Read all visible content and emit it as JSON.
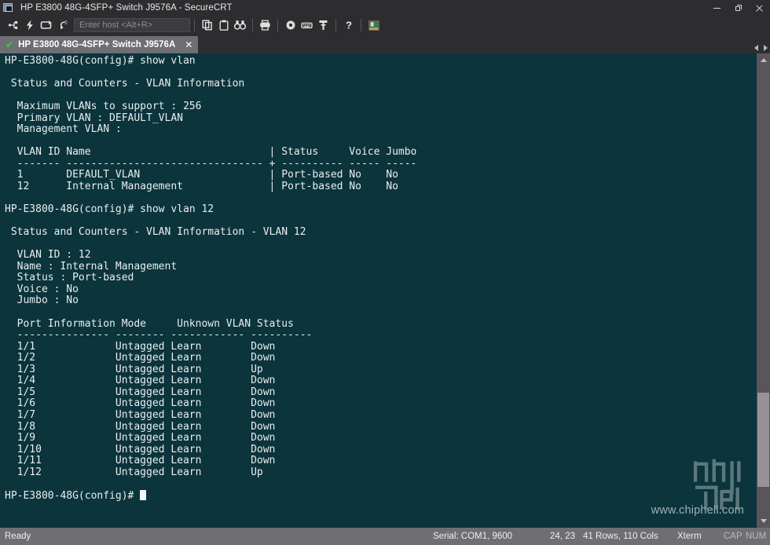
{
  "window": {
    "title": "HP E3800 48G-4SFP+ Switch J9576A - SecureCRT",
    "icon": "securecrt-app-icon",
    "controls": {
      "minimize": "minimize",
      "restore": "restore",
      "close": "close"
    }
  },
  "toolbar": {
    "buttons": [
      {
        "name": "connect-icon",
        "label": "Connect"
      },
      {
        "name": "quick-connect-icon",
        "label": "Quick Connect"
      },
      {
        "name": "reconnect-icon",
        "label": "Reconnect"
      },
      {
        "name": "disconnect-icon",
        "label": "Disconnect"
      }
    ],
    "host_input": {
      "placeholder": "Enter host <Alt+R>",
      "value": ""
    },
    "actions": [
      {
        "name": "copy-icon",
        "label": "Copy"
      },
      {
        "name": "paste-icon",
        "label": "Paste"
      },
      {
        "name": "find-icon",
        "label": "Find"
      },
      {
        "name": "print-icon",
        "label": "Print"
      },
      {
        "name": "settings-gear-icon",
        "label": "Session Options"
      },
      {
        "name": "keymap-icon",
        "label": "Keymap Editor"
      },
      {
        "name": "key-icon",
        "label": "Public Key"
      },
      {
        "name": "help-icon",
        "label": "Help"
      },
      {
        "name": "chat-window-icon",
        "label": "Chat Window"
      }
    ]
  },
  "tab": {
    "label": "HP E3800 48G-4SFP+ Switch J9576A",
    "status_glyph": "✔",
    "close_glyph": "✕",
    "nav_prev": "prev-tab",
    "nav_next": "next-tab"
  },
  "terminal": {
    "background_color": "#0b343c",
    "foreground_color": "#e9eef0",
    "cursor": "block",
    "lines": [
      "HP-E3800-48G(config)# show vlan",
      "",
      " Status and Counters - VLAN Information",
      "",
      "  Maximum VLANs to support : 256",
      "  Primary VLAN : DEFAULT_VLAN",
      "  Management VLAN :",
      "",
      "  VLAN ID Name                             | Status     Voice Jumbo",
      "  ------- -------------------------------- + ---------- ----- -----",
      "  1       DEFAULT_VLAN                     | Port-based No    No",
      "  12      Internal Management              | Port-based No    No",
      "",
      "HP-E3800-48G(config)# show vlan 12",
      "",
      " Status and Counters - VLAN Information - VLAN 12",
      "",
      "  VLAN ID : 12",
      "  Name : Internal Management",
      "  Status : Port-based",
      "  Voice : No",
      "  Jumbo : No",
      "",
      "  Port Information Mode     Unknown VLAN Status",
      "  --------------- -------- ------------ ----------",
      "  1/1             Untagged Learn        Down",
      "  1/2             Untagged Learn        Down",
      "  1/3             Untagged Learn        Up",
      "  1/4             Untagged Learn        Down",
      "  1/5             Untagged Learn        Down",
      "  1/6             Untagged Learn        Down",
      "  1/7             Untagged Learn        Down",
      "  1/8             Untagged Learn        Down",
      "  1/9             Untagged Learn        Down",
      "  1/10            Untagged Learn        Down",
      "  1/11            Untagged Learn        Down",
      "  1/12            Untagged Learn        Up",
      "",
      ""
    ],
    "prompt": "HP-E3800-48G(config)# "
  },
  "vlan_summary": {
    "maximum_vlans_to_support": "256",
    "primary_vlan": "DEFAULT_VLAN",
    "management_vlan": "",
    "columns": [
      "VLAN ID",
      "Name",
      "Status",
      "Voice",
      "Jumbo"
    ],
    "rows": [
      {
        "vlan_id": "1",
        "name": "DEFAULT_VLAN",
        "status": "Port-based",
        "voice": "No",
        "jumbo": "No"
      },
      {
        "vlan_id": "12",
        "name": "Internal Management",
        "status": "Port-based",
        "voice": "No",
        "jumbo": "No"
      }
    ]
  },
  "vlan_detail": {
    "vlan_id": "12",
    "name": "Internal Management",
    "status": "Port-based",
    "voice": "No",
    "jumbo": "No",
    "columns": [
      "Port Information",
      "Mode",
      "Unknown VLAN",
      "Status"
    ],
    "ports": [
      {
        "port": "1/1",
        "mode": "Untagged",
        "unknown_vlan": "Learn",
        "status": "Down"
      },
      {
        "port": "1/2",
        "mode": "Untagged",
        "unknown_vlan": "Learn",
        "status": "Down"
      },
      {
        "port": "1/3",
        "mode": "Untagged",
        "unknown_vlan": "Learn",
        "status": "Up"
      },
      {
        "port": "1/4",
        "mode": "Untagged",
        "unknown_vlan": "Learn",
        "status": "Down"
      },
      {
        "port": "1/5",
        "mode": "Untagged",
        "unknown_vlan": "Learn",
        "status": "Down"
      },
      {
        "port": "1/6",
        "mode": "Untagged",
        "unknown_vlan": "Learn",
        "status": "Down"
      },
      {
        "port": "1/7",
        "mode": "Untagged",
        "unknown_vlan": "Learn",
        "status": "Down"
      },
      {
        "port": "1/8",
        "mode": "Untagged",
        "unknown_vlan": "Learn",
        "status": "Down"
      },
      {
        "port": "1/9",
        "mode": "Untagged",
        "unknown_vlan": "Learn",
        "status": "Down"
      },
      {
        "port": "1/10",
        "mode": "Untagged",
        "unknown_vlan": "Learn",
        "status": "Down"
      },
      {
        "port": "1/11",
        "mode": "Untagged",
        "unknown_vlan": "Learn",
        "status": "Down"
      },
      {
        "port": "1/12",
        "mode": "Untagged",
        "unknown_vlan": "Learn",
        "status": "Up"
      }
    ]
  },
  "watermark": {
    "url": "www.chiphell.com",
    "logo_text": "chiphell"
  },
  "statusbar": {
    "state": "Ready",
    "connection": "Serial: COM1, 9600",
    "cursor_pos": "24, 23",
    "dimensions": "41 Rows, 110 Cols",
    "emulation": "Xterm",
    "caps": "CAP",
    "num": "NUM"
  }
}
